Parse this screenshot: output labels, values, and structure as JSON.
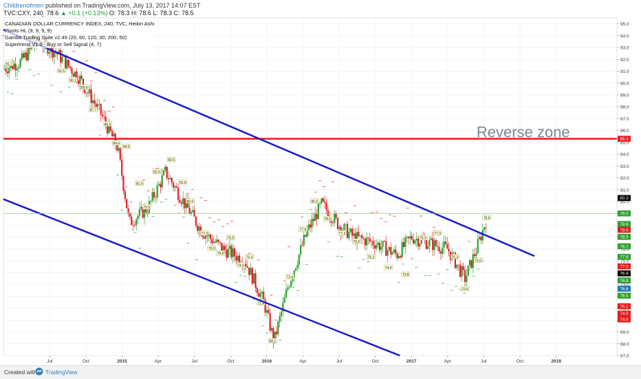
{
  "header": {
    "author": "Childrenofmen",
    "published_text": " published on TradingView.com, July 13, 2017 14:07 EST",
    "symbol": "TVC:CXY, 240",
    "last": "78.6",
    "change": "▲ +0.1 (+0.13%)",
    "ohlc": "O: 78.3 H: 78.6 L: 78.3 C: 78.5"
  },
  "legend": [
    "CANADIAN DOLLAR CURRENCY INDEX, 240, TVC, Heikin Ashi",
    "Pivots HL (9, 9, 9, 9)",
    "Gambit Trading Suite v2.49 (20, 60, 120, 30, 200, 50)",
    "Supertrend V1.0 - Buy or Sell Signal (4, 7)"
  ],
  "footer": {
    "created": "Created with",
    "brand": "TradingView"
  },
  "colors": {
    "up": "#2ca02c",
    "down": "#e0202a",
    "channel": "#1a1ac8",
    "resistance": "#e31a1c",
    "annotation": "#7b8794",
    "grid": "#eeeeee"
  },
  "chart_data": {
    "type": "candlestick",
    "ylim": [
      67.0,
      95.5
    ],
    "y_ticks": [
      95.0,
      94.0,
      93.0,
      92.0,
      91.0,
      90.0,
      89.0,
      88.0,
      87.0,
      86.0,
      85.0,
      84.0,
      83.0,
      82.0,
      81.0,
      80.0,
      79.0,
      78.0,
      77.0,
      76.0,
      75.0,
      74.0,
      73.0,
      72.0,
      71.0,
      70.0,
      69.0,
      68.0,
      67.0
    ],
    "x_ticks": [
      {
        "label": "Jul",
        "t": 2014.5
      },
      {
        "label": "Oct",
        "t": 2014.75
      },
      {
        "label": "2015",
        "t": 2015.0
      },
      {
        "label": "Apr",
        "t": 2015.25
      },
      {
        "label": "Jul",
        "t": 2015.5
      },
      {
        "label": "Oct",
        "t": 2015.75
      },
      {
        "label": "2016",
        "t": 2016.0
      },
      {
        "label": "Apr",
        "t": 2016.25
      },
      {
        "label": "Jul",
        "t": 2016.5
      },
      {
        "label": "Oct",
        "t": 2016.75
      },
      {
        "label": "2017",
        "t": 2017.0
      },
      {
        "label": "Apr",
        "t": 2017.25
      },
      {
        "label": "Jul",
        "t": 2017.5
      },
      {
        "label": "Oct",
        "t": 2017.75
      },
      {
        "label": "2018",
        "t": 2018.0
      }
    ],
    "xlim": [
      2014.18,
      2018.42
    ],
    "price_path": [
      [
        2014.18,
        91.2
      ],
      [
        2014.3,
        91.8
      ],
      [
        2014.42,
        93.6
      ],
      [
        2014.55,
        92.5
      ],
      [
        2014.7,
        90.5
      ],
      [
        2014.85,
        87.5
      ],
      [
        2014.97,
        84.5
      ],
      [
        2015.05,
        78.2
      ],
      [
        2015.18,
        79.5
      ],
      [
        2015.3,
        82.5
      ],
      [
        2015.4,
        80.5
      ],
      [
        2015.55,
        77.5
      ],
      [
        2015.7,
        76.0
      ],
      [
        2015.85,
        75.0
      ],
      [
        2015.98,
        71.5
      ],
      [
        2016.05,
        68.2
      ],
      [
        2016.15,
        73.0
      ],
      [
        2016.28,
        77.5
      ],
      [
        2016.38,
        79.8
      ],
      [
        2016.5,
        78.0
      ],
      [
        2016.6,
        77.0
      ],
      [
        2016.75,
        76.5
      ],
      [
        2016.9,
        75.5
      ],
      [
        2017.0,
        77.0
      ],
      [
        2017.12,
        76.5
      ],
      [
        2017.25,
        76.0
      ],
      [
        2017.37,
        73.5
      ],
      [
        2017.45,
        76.0
      ],
      [
        2017.52,
        78.6
      ]
    ],
    "right_badges": [
      {
        "value": 85.3,
        "label": "85.3",
        "color": "#e31a1c"
      },
      {
        "value": 80.3,
        "label": "80.3",
        "color": "#000000"
      },
      {
        "value": 79.0,
        "label": "79.0",
        "color": "#2ca02c"
      },
      {
        "value": 78.6,
        "label": "78.6",
        "color": "#2ca02c"
      },
      {
        "value": 78.6,
        "label": "78.6",
        "color": "#e31a1c"
      },
      {
        "value": 78.5,
        "label": "78.5",
        "color": "#2ca02c"
      },
      {
        "value": 78.2,
        "label": "78.2",
        "color": "#2ca02c"
      },
      {
        "value": 77.8,
        "label": "77.8",
        "color": "#2ca02c"
      },
      {
        "value": 77.0,
        "label": "77.0",
        "color": "#e31a1c"
      },
      {
        "value": 76.9,
        "label": "76.9",
        "color": "#000000"
      },
      {
        "value": 76.8,
        "label": "76.8",
        "color": "#2ca02c"
      },
      {
        "value": 76.6,
        "label": "76.6",
        "color": "#1f77b4"
      },
      {
        "value": 76.5,
        "label": "76.5",
        "color": "#2ca02c"
      },
      {
        "value": 76.1,
        "label": "76.1",
        "color": "#e31a1c"
      },
      {
        "value": 74.0,
        "label": "74.0",
        "color": "#e31a1c"
      },
      {
        "value": 74.0,
        "label": "74.0",
        "color": "#e31a1c"
      }
    ],
    "lines": {
      "resistance": {
        "value": 85.3,
        "label": "Reverse zone"
      },
      "channel_upper": [
        [
          2014.18,
          94.5
        ],
        [
          2017.85,
          75.4
        ]
      ],
      "channel_lower": [
        [
          2014.18,
          80.2
        ],
        [
          2016.92,
          67.0
        ]
      ],
      "current_price": 79.0
    },
    "pivot_labels": [
      {
        "t": 2014.22,
        "v": 91.6,
        "label": "91.7"
      },
      {
        "t": 2014.4,
        "v": 93.9,
        "label": "93.9"
      },
      {
        "t": 2014.48,
        "v": 93.1,
        "label": "93.0"
      },
      {
        "t": 2014.58,
        "v": 91.0,
        "label": "91.5"
      },
      {
        "t": 2014.66,
        "v": 90.2,
        "label": "90.1"
      },
      {
        "t": 2014.74,
        "v": 89.6,
        "label": "89.6"
      },
      {
        "t": 2014.8,
        "v": 87.7,
        "label": "87.7"
      },
      {
        "t": 2014.9,
        "v": 86.5,
        "label": "86.6"
      },
      {
        "t": 2014.96,
        "v": 84.9,
        "label": "84.9"
      },
      {
        "t": 2015.03,
        "v": 84.6,
        "label": "84.6"
      },
      {
        "t": 2015.12,
        "v": 81.5,
        "label": "81.5"
      },
      {
        "t": 2015.17,
        "v": 79.5,
        "label": "79.5"
      },
      {
        "t": 2015.24,
        "v": 82.5,
        "label": "82.5"
      },
      {
        "t": 2015.34,
        "v": 83.5,
        "label": "83.5"
      },
      {
        "t": 2015.42,
        "v": 81.6,
        "label": "81.6"
      },
      {
        "t": 2015.47,
        "v": 80.0,
        "label": "80.0"
      },
      {
        "t": 2015.57,
        "v": 77.3,
        "label": "77.3"
      },
      {
        "t": 2015.62,
        "v": 76.0,
        "label": "76.0"
      },
      {
        "t": 2015.68,
        "v": 75.6,
        "label": "75.6"
      },
      {
        "t": 2015.75,
        "v": 76.9,
        "label": "76.9"
      },
      {
        "t": 2015.82,
        "v": 74.6,
        "label": "74.6"
      },
      {
        "t": 2015.88,
        "v": 75.3,
        "label": "75.3"
      },
      {
        "t": 2015.96,
        "v": 71.4,
        "label": "71.4"
      },
      {
        "t": 2016.04,
        "v": 68.2,
        "label": "68.2"
      },
      {
        "t": 2016.16,
        "v": 73.6,
        "label": "73.6"
      },
      {
        "t": 2016.25,
        "v": 77.6,
        "label": "77.6"
      },
      {
        "t": 2016.33,
        "v": 80.0,
        "label": "80.0"
      },
      {
        "t": 2016.42,
        "v": 78.5,
        "label": "78.5"
      },
      {
        "t": 2016.52,
        "v": 77.3,
        "label": "77.3"
      },
      {
        "t": 2016.62,
        "v": 76.6,
        "label": "76.6"
      },
      {
        "t": 2016.72,
        "v": 75.3,
        "label": "75.3"
      },
      {
        "t": 2016.84,
        "v": 74.4,
        "label": "74.4"
      },
      {
        "t": 2016.96,
        "v": 73.8,
        "label": "73.8"
      },
      {
        "t": 2017.08,
        "v": 76.9,
        "label": "76.9"
      },
      {
        "t": 2017.18,
        "v": 77.3,
        "label": "77.3"
      },
      {
        "t": 2017.3,
        "v": 75.3,
        "label": "75.3"
      },
      {
        "t": 2017.37,
        "v": 72.6,
        "label": "72.6"
      },
      {
        "t": 2017.46,
        "v": 75.0,
        "label": "75.0"
      },
      {
        "t": 2017.52,
        "v": 78.6,
        "label": "78.6"
      }
    ]
  }
}
